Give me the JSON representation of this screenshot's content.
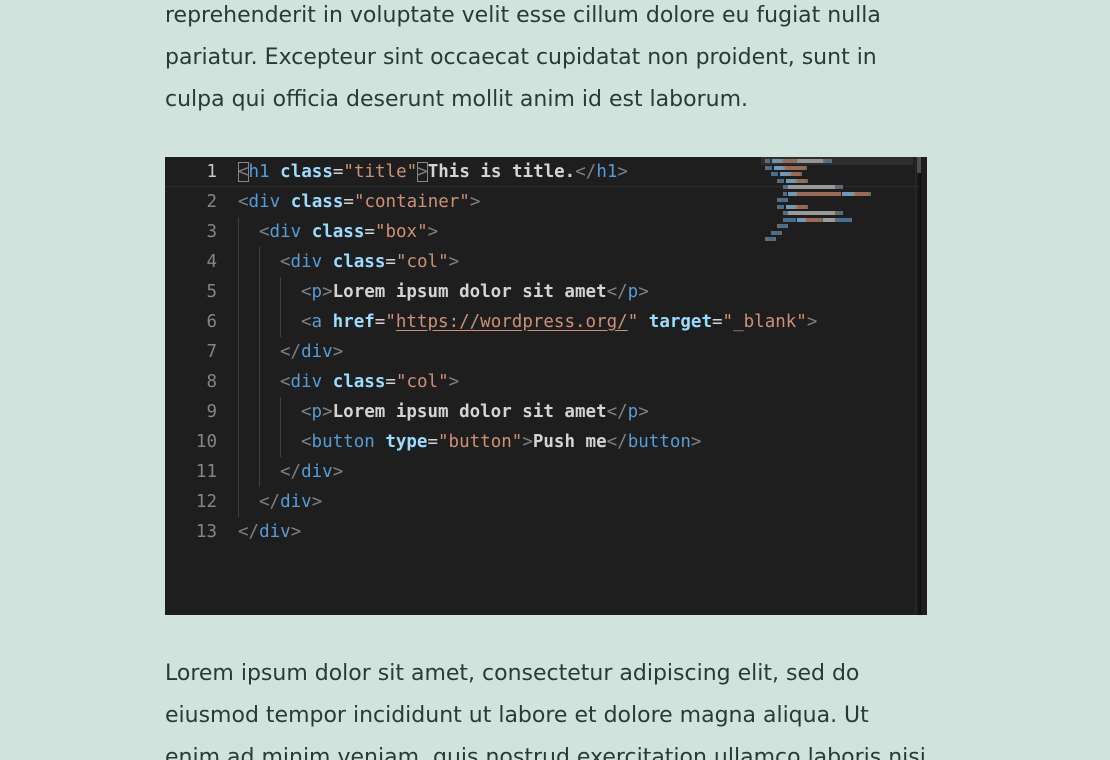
{
  "paragraph_top": {
    "lines": [
      "reprehenderit in voluptate velit esse cillum dolore eu fugiat nulla",
      "pariatur. Excepteur sint occaecat cupidatat non proident, sunt in",
      "culpa qui officia deserunt mollit anim id est laborum."
    ]
  },
  "editor": {
    "current_line": 1,
    "lines": [
      {
        "num": "1",
        "indent": 0,
        "tokens": [
          [
            "punc",
            "<",
            true
          ],
          [
            "tag",
            "h1"
          ],
          [
            "sp",
            " "
          ],
          [
            "attr",
            "class"
          ],
          [
            "eq",
            "="
          ],
          [
            "str",
            "\"title\""
          ],
          [
            "punc",
            ">",
            true
          ],
          [
            "text",
            "This is title."
          ],
          [
            "punc",
            "</"
          ],
          [
            "tag",
            "h1"
          ],
          [
            "punc",
            ">"
          ]
        ]
      },
      {
        "num": "2",
        "indent": 0,
        "tokens": [
          [
            "punc",
            "<"
          ],
          [
            "tag",
            "div"
          ],
          [
            "sp",
            " "
          ],
          [
            "attr",
            "class"
          ],
          [
            "eq",
            "="
          ],
          [
            "str",
            "\"container\""
          ],
          [
            "punc",
            ">"
          ]
        ]
      },
      {
        "num": "3",
        "indent": 1,
        "tokens": [
          [
            "punc",
            "<"
          ],
          [
            "tag",
            "div"
          ],
          [
            "sp",
            " "
          ],
          [
            "attr",
            "class"
          ],
          [
            "eq",
            "="
          ],
          [
            "str",
            "\"box\""
          ],
          [
            "punc",
            ">"
          ]
        ]
      },
      {
        "num": "4",
        "indent": 2,
        "tokens": [
          [
            "punc",
            "<"
          ],
          [
            "tag",
            "div"
          ],
          [
            "sp",
            " "
          ],
          [
            "attr",
            "class"
          ],
          [
            "eq",
            "="
          ],
          [
            "str",
            "\"col\""
          ],
          [
            "punc",
            ">"
          ]
        ]
      },
      {
        "num": "5",
        "indent": 3,
        "tokens": [
          [
            "punc",
            "<"
          ],
          [
            "tag",
            "p"
          ],
          [
            "punc",
            ">"
          ],
          [
            "text",
            "Lorem ipsum dolor sit amet"
          ],
          [
            "punc",
            "</"
          ],
          [
            "tag",
            "p"
          ],
          [
            "punc",
            ">"
          ]
        ]
      },
      {
        "num": "6",
        "indent": 3,
        "tokens": [
          [
            "punc",
            "<"
          ],
          [
            "tag",
            "a"
          ],
          [
            "sp",
            " "
          ],
          [
            "attr",
            "href"
          ],
          [
            "eq",
            "="
          ],
          [
            "str",
            "\""
          ],
          [
            "link",
            "https://wordpress.org/"
          ],
          [
            "str",
            "\""
          ],
          [
            "sp",
            " "
          ],
          [
            "attr",
            "target"
          ],
          [
            "eq",
            "="
          ],
          [
            "str",
            "\"_blank\""
          ],
          [
            "punc",
            ">"
          ]
        ]
      },
      {
        "num": "7",
        "indent": 2,
        "tokens": [
          [
            "punc",
            "</"
          ],
          [
            "tag",
            "div"
          ],
          [
            "punc",
            ">"
          ]
        ]
      },
      {
        "num": "8",
        "indent": 2,
        "tokens": [
          [
            "punc",
            "<"
          ],
          [
            "tag",
            "div"
          ],
          [
            "sp",
            " "
          ],
          [
            "attr",
            "class"
          ],
          [
            "eq",
            "="
          ],
          [
            "str",
            "\"col\""
          ],
          [
            "punc",
            ">"
          ]
        ]
      },
      {
        "num": "9",
        "indent": 3,
        "tokens": [
          [
            "punc",
            "<"
          ],
          [
            "tag",
            "p"
          ],
          [
            "punc",
            ">"
          ],
          [
            "text",
            "Lorem ipsum dolor sit amet"
          ],
          [
            "punc",
            "</"
          ],
          [
            "tag",
            "p"
          ],
          [
            "punc",
            ">"
          ]
        ]
      },
      {
        "num": "10",
        "indent": 3,
        "tokens": [
          [
            "punc",
            "<"
          ],
          [
            "tag",
            "button"
          ],
          [
            "sp",
            " "
          ],
          [
            "attr",
            "type"
          ],
          [
            "eq",
            "="
          ],
          [
            "str",
            "\"button\""
          ],
          [
            "punc",
            ">"
          ],
          [
            "text",
            "Push me"
          ],
          [
            "punc",
            "</"
          ],
          [
            "tag",
            "button"
          ],
          [
            "punc",
            ">"
          ]
        ]
      },
      {
        "num": "11",
        "indent": 2,
        "tokens": [
          [
            "punc",
            "</"
          ],
          [
            "tag",
            "div"
          ],
          [
            "punc",
            ">"
          ]
        ]
      },
      {
        "num": "12",
        "indent": 1,
        "tokens": [
          [
            "punc",
            "</"
          ],
          [
            "tag",
            "div"
          ],
          [
            "punc",
            ">"
          ]
        ]
      },
      {
        "num": "13",
        "indent": 0,
        "tokens": [
          [
            "punc",
            "</"
          ],
          [
            "tag",
            "div"
          ],
          [
            "punc",
            ">"
          ]
        ]
      }
    ],
    "colors": {
      "background": "#1e1e1e",
      "tag": "#569cd6",
      "attribute": "#9cdcfe",
      "string": "#ce9178",
      "text": "#d4d4d4",
      "punctuation": "#808080"
    }
  },
  "paragraph_bottom": {
    "lines": [
      "Lorem ipsum dolor sit amet, consectetur adipiscing elit, sed do",
      "eiusmod tempor incididunt ut labore et dolore magna aliqua. Ut",
      "enim ad minim veniam, quis nostrud exercitation ullamco laboris nisi"
    ]
  },
  "page_colors": {
    "background": "#d0e4dd",
    "text": "#2b3a36"
  }
}
